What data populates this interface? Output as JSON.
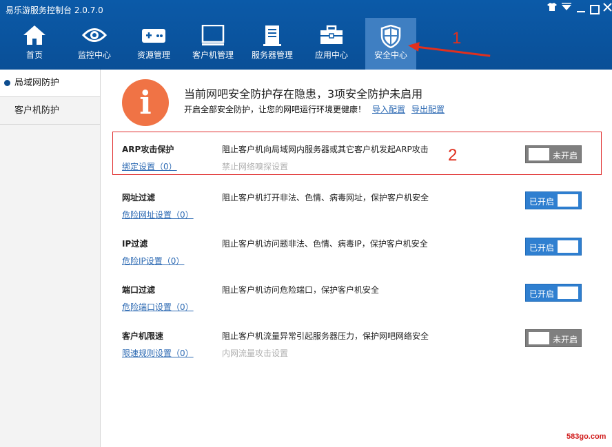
{
  "app": {
    "title": "易乐游服务控制台 2.0.7.0"
  },
  "window_controls": [
    "shirt-icon",
    "menu-dropdown-icon",
    "minimize-icon",
    "maximize-icon",
    "close-icon"
  ],
  "nav": {
    "items": [
      {
        "label": "首页",
        "icon": "home-icon"
      },
      {
        "label": "监控中心",
        "icon": "eye-icon"
      },
      {
        "label": "资源管理",
        "icon": "gamepad-icon"
      },
      {
        "label": "客户机管理",
        "icon": "monitor-icon"
      },
      {
        "label": "服务器管理",
        "icon": "server-icon"
      },
      {
        "label": "应用中心",
        "icon": "toolbox-icon"
      },
      {
        "label": "安全中心",
        "icon": "shield-icon"
      }
    ],
    "active_index": 6
  },
  "annotations": {
    "num1": "1",
    "num2": "2"
  },
  "sidebar": {
    "items": [
      {
        "label": "局域网防护",
        "active": true
      },
      {
        "label": "客户机防护",
        "active": false
      }
    ]
  },
  "banner": {
    "icon_glyph": "i",
    "title": "当前网吧安全防护存在隐患，3项安全防护未启用",
    "subtitle": "开启全部安全防护，让您的网吧运行环境更健康！",
    "link_import": "导入配置",
    "link_export": "导出配置"
  },
  "rows": [
    {
      "name": "ARP攻击保护",
      "link": "绑定设置（0）",
      "desc": "阻止客户机向局域网内服务器或其它客户机发起ARP攻击",
      "hint": "禁止网络嗅探设置",
      "state": "off",
      "toggle_label": "未开启"
    },
    {
      "name": "网址过滤",
      "link": "危险网址设置（0）",
      "desc": "阻止客户机打开非法、色情、病毒网址，保护客户机安全",
      "hint": "",
      "state": "on",
      "toggle_label": "已开启"
    },
    {
      "name": "IP过滤",
      "link": "危险IP设置（0）",
      "desc": "阻止客户机访问题非法、色情、病毒IP，保护客户机安全",
      "hint": "",
      "state": "on",
      "toggle_label": "已开启"
    },
    {
      "name": "端口过滤",
      "link": "危险端口设置（0）",
      "desc": "阻止客户机访问危险端口，保护客户机安全",
      "hint": "",
      "state": "on",
      "toggle_label": "已开启"
    },
    {
      "name": "客户机限速",
      "link": "限速规则设置（0）",
      "desc": "阻止客户机流量异常引起服务器压力，保护网吧网络安全",
      "hint": "内网流量攻击设置",
      "state": "off",
      "toggle_label": "未开启"
    }
  ],
  "watermark": "583go.com",
  "colors": {
    "header": "#0b5aa8",
    "nav_active": "#3f7fc2",
    "toggle_on": "#2f7fd0",
    "toggle_off": "#7f7f7f",
    "warning": "#f07345",
    "annotation": "#e0301e",
    "link": "#2d6ab3"
  }
}
